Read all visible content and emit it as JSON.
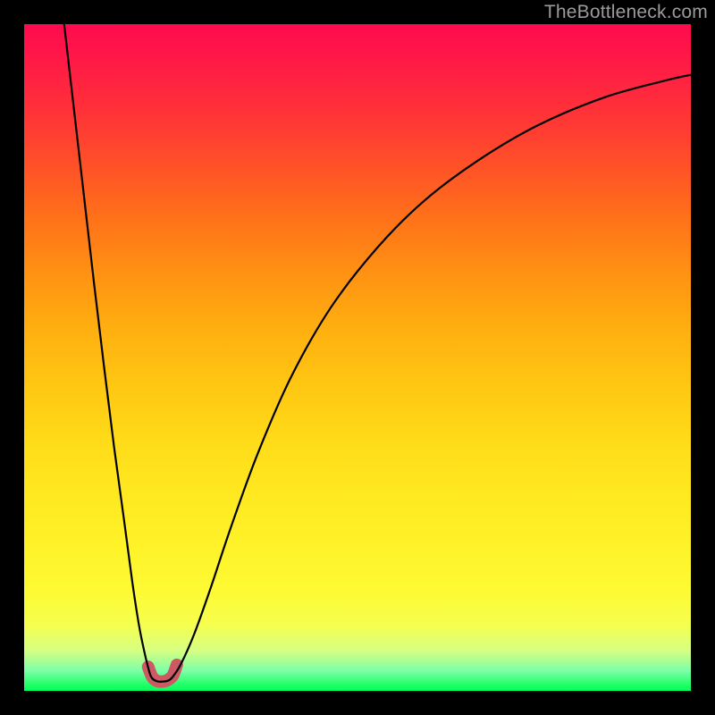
{
  "watermark": "TheBottleneck.com",
  "chart_data": {
    "type": "line",
    "title": "",
    "xlabel": "",
    "ylabel": "",
    "xlim": [
      0,
      1
    ],
    "ylim": [
      0,
      1
    ],
    "series": [
      {
        "name": "left-branch",
        "x": [
          0.06,
          0.075,
          0.09,
          0.105,
          0.12,
          0.135,
          0.15,
          0.162,
          0.172,
          0.18,
          0.186,
          0.19,
          0.194
        ],
        "y": [
          1.0,
          0.87,
          0.74,
          0.61,
          0.485,
          0.365,
          0.255,
          0.165,
          0.1,
          0.06,
          0.035,
          0.022,
          0.017
        ]
      },
      {
        "name": "trough",
        "x": [
          0.194,
          0.201,
          0.208,
          0.215,
          0.222
        ],
        "y": [
          0.017,
          0.014,
          0.014,
          0.015,
          0.02
        ]
      },
      {
        "name": "right-branch",
        "x": [
          0.222,
          0.235,
          0.255,
          0.28,
          0.31,
          0.35,
          0.4,
          0.46,
          0.53,
          0.6,
          0.68,
          0.77,
          0.87,
          0.96,
          1.0
        ],
        "y": [
          0.02,
          0.04,
          0.085,
          0.155,
          0.245,
          0.355,
          0.47,
          0.575,
          0.665,
          0.735,
          0.795,
          0.848,
          0.89,
          0.915,
          0.924
        ]
      }
    ],
    "marker": {
      "name": "trough-marker",
      "color": "#cc5a64",
      "x": [
        0.186,
        0.192,
        0.199,
        0.207,
        0.215,
        0.223,
        0.229
      ],
      "y": [
        0.036,
        0.021,
        0.015,
        0.014,
        0.016,
        0.023,
        0.039
      ]
    }
  },
  "colors": {
    "curve": "#000000",
    "marker": "#cc5a64",
    "background_top": "#ff0a4e",
    "background_bottom": "#00ff57",
    "frame": "#000000"
  }
}
